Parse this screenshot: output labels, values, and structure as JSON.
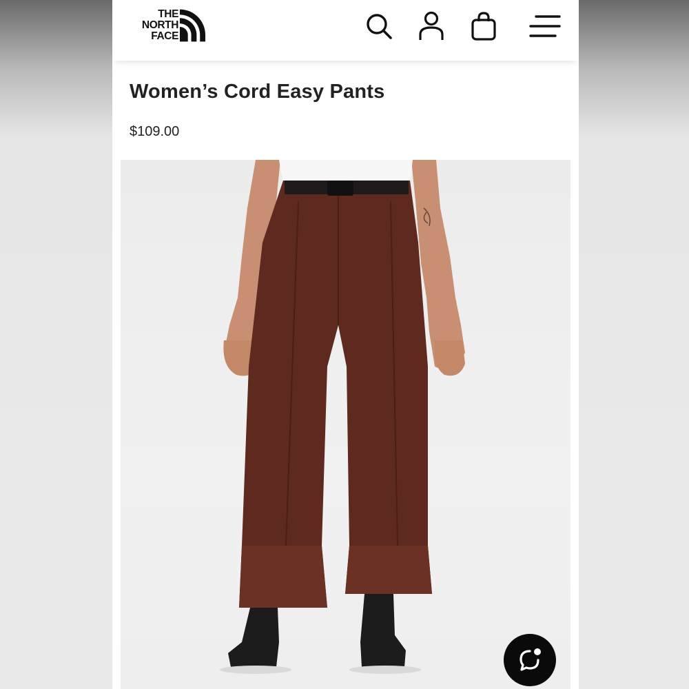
{
  "brand": {
    "logo_lines": [
      "THE",
      "NORTH",
      "FACE"
    ]
  },
  "header": {
    "icons": [
      "search-icon",
      "account-icon",
      "bag-icon",
      "menu-icon"
    ]
  },
  "product": {
    "title": "Women’s Cord Easy Pants",
    "price": "$109.00",
    "image_subject": "brown corduroy wide-leg pants worn with white tee and black boots",
    "colors": {
      "pants": "#5e2a1f",
      "background": "#efefef"
    }
  },
  "chat": {
    "icon": "chat-bubble-icon"
  }
}
